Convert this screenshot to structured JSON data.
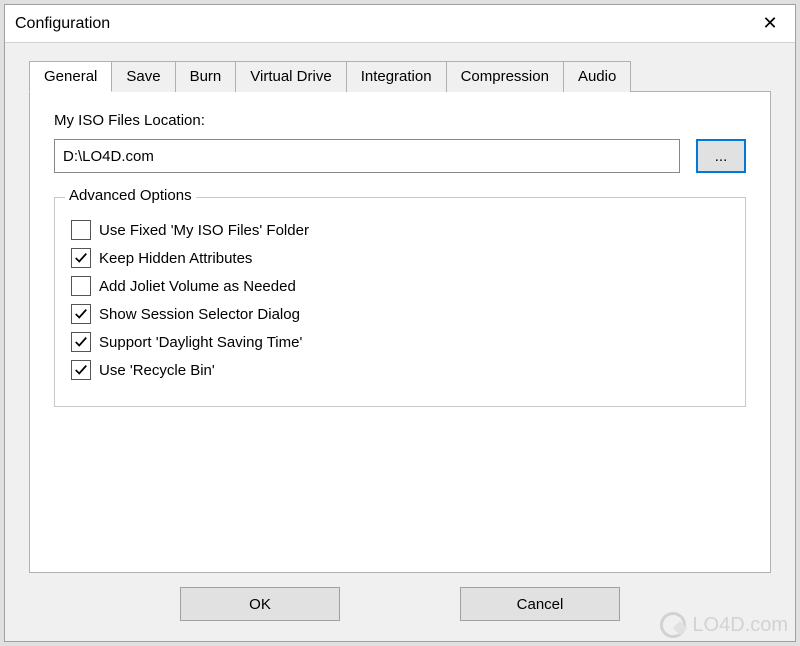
{
  "window": {
    "title": "Configuration",
    "close_label": "✕"
  },
  "tabs": [
    {
      "label": "General",
      "active": true
    },
    {
      "label": "Save",
      "active": false
    },
    {
      "label": "Burn",
      "active": false
    },
    {
      "label": "Virtual Drive",
      "active": false
    },
    {
      "label": "Integration",
      "active": false
    },
    {
      "label": "Compression",
      "active": false
    },
    {
      "label": "Audio",
      "active": false
    }
  ],
  "general": {
    "iso_location_label": "My ISO Files Location:",
    "iso_location_value": "D:\\LO4D.com",
    "browse_button_label": "...",
    "advanced_group_label": "Advanced Options",
    "options": [
      {
        "label": "Use Fixed 'My ISO Files' Folder",
        "checked": false
      },
      {
        "label": "Keep Hidden Attributes",
        "checked": true
      },
      {
        "label": "Add Joliet Volume as Needed",
        "checked": false
      },
      {
        "label": "Show Session Selector Dialog",
        "checked": true
      },
      {
        "label": "Support 'Daylight Saving Time'",
        "checked": true
      },
      {
        "label": "Use 'Recycle Bin'",
        "checked": true
      }
    ]
  },
  "buttons": {
    "ok": "OK",
    "cancel": "Cancel"
  },
  "watermark": "LO4D.com"
}
